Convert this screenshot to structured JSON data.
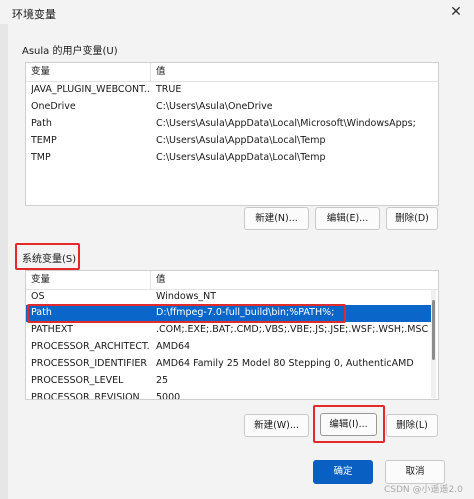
{
  "window": {
    "title": "环境变量",
    "close_glyph": "✕"
  },
  "user_vars": {
    "label": "Asula 的用户变量(U)",
    "columns": [
      "变量",
      "值"
    ],
    "rows": [
      {
        "name": "JAVA_PLUGIN_WEBCONT...",
        "value": "TRUE"
      },
      {
        "name": "OneDrive",
        "value": "C:\\Users\\Asula\\OneDrive"
      },
      {
        "name": "Path",
        "value": "C:\\Users\\Asula\\AppData\\Local\\Microsoft\\WindowsApps;"
      },
      {
        "name": "TEMP",
        "value": "C:\\Users\\Asula\\AppData\\Local\\Temp"
      },
      {
        "name": "TMP",
        "value": "C:\\Users\\Asula\\AppData\\Local\\Temp"
      }
    ],
    "buttons": {
      "new": "新建(N)...",
      "edit": "编辑(E)...",
      "delete": "删除(D)"
    }
  },
  "system_vars": {
    "label": "系统变量(S)",
    "columns": [
      "变量",
      "值"
    ],
    "rows": [
      {
        "name": "OS",
        "value": "Windows_NT"
      },
      {
        "name": "Path",
        "value": "D:\\ffmpeg-7.0-full_build\\bin;%PATH%;"
      },
      {
        "name": "PATHEXT",
        "value": ".COM;.EXE;.BAT;.CMD;.VBS;.VBE;.JS;.JSE;.WSF;.WSH;.MSC"
      },
      {
        "name": "PROCESSOR_ARCHITECT...",
        "value": "AMD64"
      },
      {
        "name": "PROCESSOR_IDENTIFIER",
        "value": "AMD64 Family 25 Model 80 Stepping 0, AuthenticAMD"
      },
      {
        "name": "PROCESSOR_LEVEL",
        "value": "25"
      },
      {
        "name": "PROCESSOR_REVISION",
        "value": "5000"
      }
    ],
    "selected_row": "Path",
    "buttons": {
      "new": "新建(W)...",
      "edit": "编辑(I)...",
      "delete": "删除(L)"
    }
  },
  "footer": {
    "ok": "确定",
    "cancel": "取消",
    "watermark": "CSDN @小遥遥2.0"
  },
  "colors": {
    "selection": "#0a66c9",
    "primary": "#0a5fc3",
    "highlight_box": "#e22a2a"
  }
}
